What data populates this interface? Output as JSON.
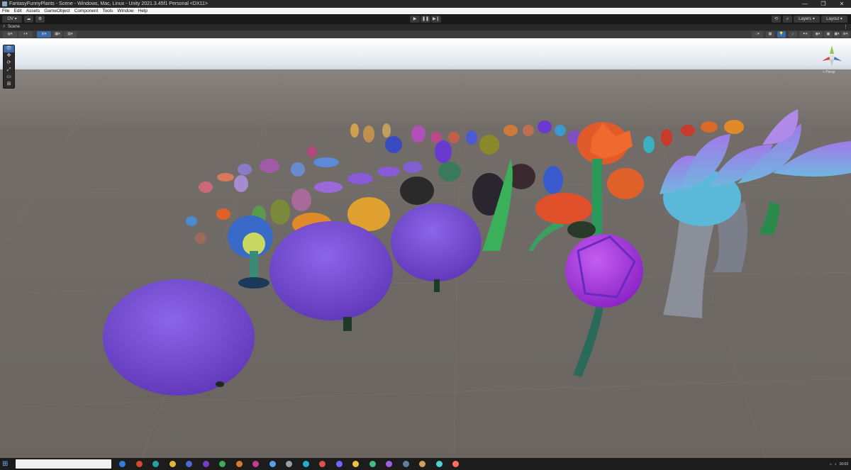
{
  "window": {
    "title": "FantasyFunnyPlants - Scene - Windows, Mac, Linux - Unity 2021.3.45f1 Personal <DX11>",
    "minimize": "—",
    "maximize": "❐",
    "close": "✕"
  },
  "menu": [
    "File",
    "Edit",
    "Assets",
    "GameObject",
    "Component",
    "Tools",
    "Window",
    "Help"
  ],
  "toolbar": {
    "account_label": "OV ▾",
    "cloud_icon": "cloud-icon",
    "collab_icon": "collab-icon",
    "play_icon": "▶",
    "pause_icon": "❚❚",
    "step_icon": "▶❙",
    "history_icon": "⟲",
    "search_icon": "🔍",
    "layers_label": "Layers ▾",
    "layout_label": "Layout ▾"
  },
  "scene_tab": {
    "label": "Scene",
    "menu_icon": "⋮"
  },
  "scene_toolbar": {
    "left_items": [
      "◍▾",
      "◐▾",
      "⊞▾",
      "▦▾",
      "▤▾"
    ],
    "right_items": [
      "◌▾",
      "▦",
      "💡",
      "♪",
      "✦▾",
      "◉▾",
      "▣",
      "▣▾",
      "⊕▾"
    ]
  },
  "tools": [
    "👁",
    "✥",
    "⟳",
    "⤢",
    "▭",
    "⊞"
  ],
  "gizmo": {
    "label": "< Persp"
  },
  "taskbar": {
    "start_icon": "⊞",
    "search_placeholder": "",
    "apps": [
      "#2f7fd8",
      "#d04a2b",
      "#2aa0a0",
      "#e8b33a",
      "#4b6bd0",
      "#7a3ccf",
      "#3cae5b",
      "#d8792c",
      "#c03d8f",
      "#58a0e8",
      "#9aa0a6",
      "#20b0d0",
      "#e05050",
      "#6a6aff",
      "#f0c040",
      "#40c080",
      "#a060e0",
      "#6080a0",
      "#d0a060",
      "#50d0d0",
      "#ff7060"
    ],
    "clock_time": "10:03",
    "clock_date": ""
  },
  "colors": {
    "sky_top": "#ffffff",
    "sky_horizon": "#c9d6e3",
    "ground": "#6f6a66",
    "blob_purple": "#7a4fd6",
    "accent": "#3a6aa8"
  }
}
